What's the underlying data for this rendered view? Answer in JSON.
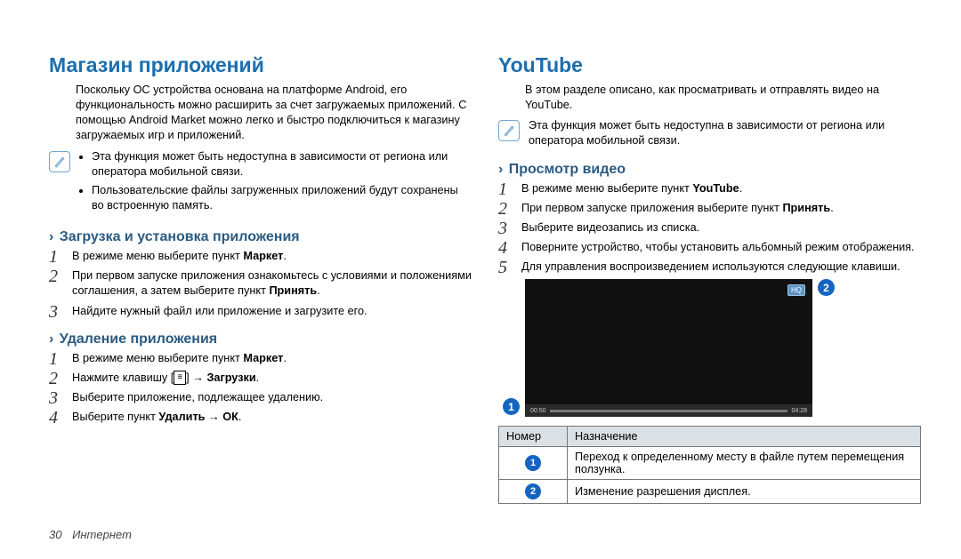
{
  "left": {
    "heading": "Магазин приложений",
    "intro": "Поскольку ОС устройства основана на платформе Android, его функциональность можно расширить за счет загружаемых приложений. С помощью Android Market можно легко и быстро подключиться к магазину загружаемых игр и приложений.",
    "note1": "Эта функция может быть недоступна в зависимости от региона или оператора мобильной связи.",
    "note2": "Пользовательские файлы загруженных приложений будут сохранены во встроенную память.",
    "secA_heading": "Загрузка и установка приложения",
    "secA_steps": {
      "s1a": "В режиме меню выберите пункт ",
      "s1b": "Маркет",
      "s1c": ".",
      "s2a": "При первом запуске приложения ознакомьтесь с условиями и положениями соглашения, а затем выберите пункт ",
      "s2b": "Принять",
      "s2c": ".",
      "s3": "Найдите нужный файл или приложение и загрузите его."
    },
    "secB_heading": "Удаление приложения",
    "secB_steps": {
      "s1a": "В режиме меню выберите пункт ",
      "s1b": "Маркет",
      "s1c": ".",
      "s2a": "Нажмите клавишу [",
      "s2b": "] → ",
      "s2c": "Загрузки",
      "s2d": ".",
      "s3": "Выберите приложение, подлежащее удалению.",
      "s4a": "Выберите пункт ",
      "s4b": "Удалить → ОК",
      "s4c": "."
    }
  },
  "right": {
    "heading": "YouTube",
    "intro": "В этом разделе описано, как просматривать и отправлять видео на YouTube.",
    "note1": "Эта функция может быть недоступна в зависимости от региона или оператора мобильной связи.",
    "secA_heading": "Просмотр видео",
    "secA_steps": {
      "s1a": "В режиме меню выберите пункт ",
      "s1b": "YouTube",
      "s1c": ".",
      "s2a": "При первом запуске приложения выберите пункт ",
      "s2b": "Принять",
      "s2c": ".",
      "s3": "Выберите видеозапись из списка.",
      "s4": "Поверните устройство, чтобы установить альбомный режим отображения.",
      "s5": "Для управления воспроизведением используются следующие клавиши."
    },
    "video": {
      "t1": "00:50",
      "t2": "04:28",
      "hq": "HQ"
    },
    "callouts": {
      "c1": "1",
      "c2": "2"
    },
    "table": {
      "h1": "Номер",
      "h2": "Назначение",
      "r1n": "1",
      "r1t": "Переход к определенному месту в файле путем перемещения ползунка.",
      "r2n": "2",
      "r2t": "Изменение разрешения дисплея."
    }
  },
  "footer": {
    "page": "30",
    "chapter": "Интернет"
  }
}
